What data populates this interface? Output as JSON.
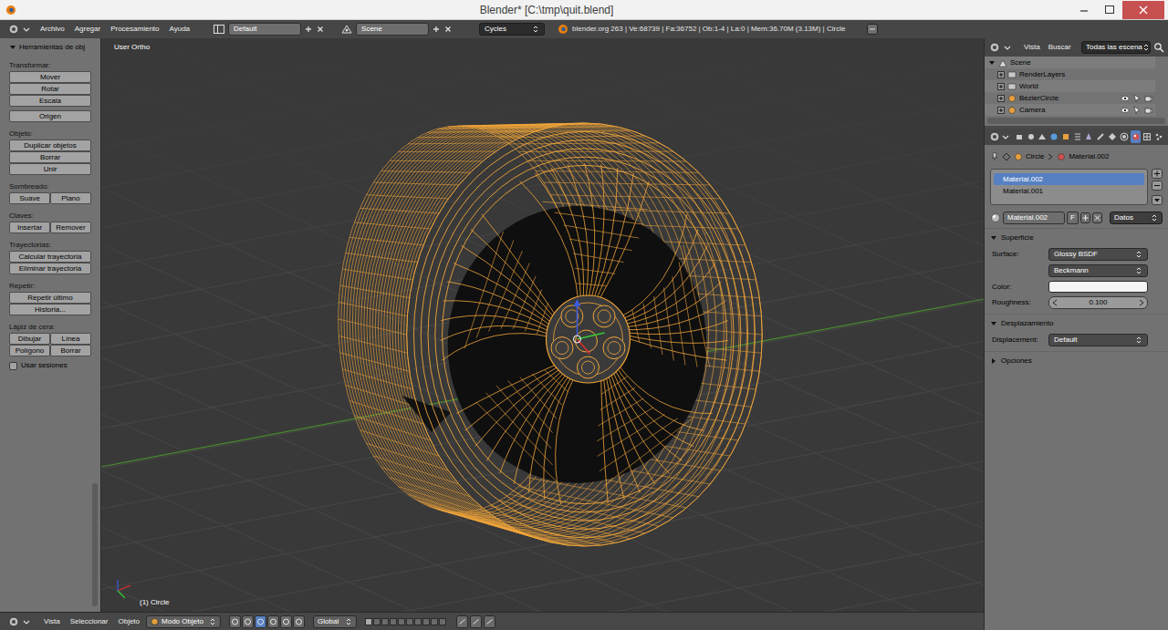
{
  "window": {
    "title": "Blender* [C:\\tmp\\quit.blend]"
  },
  "info_header": {
    "menus": [
      "Archivo",
      "Agregar",
      "Procesamiento",
      "Ayuda"
    ],
    "layout": "Default",
    "scene": "Scene",
    "engine": "Cycles",
    "stats": "blender.org 263 | Ve:68739 | Fa:36752 | Ob:1-4 | La:0 | Mem:36.70M (3.13M) | Circle"
  },
  "tool_shelf": {
    "title": "Herramientas de obj",
    "expanded": true,
    "sections": [
      {
        "label": "Transformar:",
        "rows": [
          [
            "Mover"
          ],
          [
            "Rotar"
          ],
          [
            "Escala"
          ]
        ]
      },
      {
        "rows": [
          [
            "Origen"
          ]
        ]
      },
      {
        "label": "Objeto:",
        "rows": [
          [
            "Duplicar objetos"
          ],
          [
            "Borrar"
          ],
          [
            "Unir"
          ]
        ]
      },
      {
        "label": "Sombreado:",
        "rows": [
          [
            "Suave",
            "Plano"
          ]
        ]
      },
      {
        "label": "Claves:",
        "rows": [
          [
            "Insertar",
            "Remover"
          ]
        ]
      },
      {
        "label": "Trayectorias:",
        "rows": [
          [
            "Calcular trayectoria"
          ],
          [
            "Eliminar trayectoria"
          ]
        ]
      },
      {
        "label": "Repetir:",
        "rows": [
          [
            "Repetir último"
          ],
          [
            "Historia..."
          ]
        ]
      },
      {
        "label": "Lápiz de cera:",
        "rows": [
          [
            "Dibujar",
            "Línea"
          ],
          [
            "Polígono",
            "Borrar"
          ]
        ]
      }
    ],
    "option": {
      "label": "Usar sesiones",
      "checked": false
    }
  },
  "viewport": {
    "view": "User Ortho",
    "object": "(1) Circle"
  },
  "bottom_header": {
    "menus": [
      "Vista",
      "Seleccionar",
      "Objeto"
    ],
    "mode": "Modo Objeto",
    "orientation": "Global"
  },
  "outliner": {
    "menus": [
      "Vista",
      "Buscar"
    ],
    "filter": "Todas las escena",
    "items": [
      {
        "label": "Scene",
        "kind": "scene",
        "expanded": true
      },
      {
        "label": "RenderLayers",
        "kind": "data",
        "expanded": false
      },
      {
        "label": "World",
        "kind": "data",
        "expanded": false
      },
      {
        "label": "BezierCircle",
        "kind": "object",
        "expanded": false
      },
      {
        "label": "Camera",
        "kind": "object",
        "expanded": false
      }
    ]
  },
  "properties": {
    "tabs": [
      {
        "selected": false
      },
      {
        "selected": false
      },
      {
        "selected": false
      },
      {
        "selected": false
      },
      {
        "selected": false
      },
      {
        "selected": false
      },
      {
        "selected": false
      },
      {
        "selected": false
      },
      {
        "selected": false
      },
      {
        "selected": false
      },
      {
        "selected": true
      },
      {
        "selected": false
      },
      {
        "selected": false
      }
    ],
    "breadcrumb": [
      "Circle",
      "Material.002"
    ],
    "materials": [
      {
        "label": "Material.002",
        "selected": true
      },
      {
        "label": "Material.001",
        "selected": false
      }
    ],
    "material_name": "Material.002",
    "fake_user": "F",
    "link": "Datos",
    "panels": [
      {
        "title": "Superficie",
        "expanded": true,
        "rows": [
          {
            "kind": "dropdown",
            "label": "Surface:",
            "value": "Glossy BSDF"
          },
          {
            "kind": "dropdown",
            "value": "Beckmann"
          },
          {
            "kind": "color",
            "label": "Color:",
            "color": "#f4f4f4"
          },
          {
            "kind": "number",
            "label": "Roughness:",
            "value": "0.100"
          }
        ]
      },
      {
        "title": "Desplazamiento",
        "expanded": true,
        "rows": [
          {
            "kind": "dropdown",
            "label": "Displacement:",
            "value": "Default"
          }
        ]
      },
      {
        "title": "Opciones",
        "expanded": false,
        "rows": []
      }
    ]
  }
}
